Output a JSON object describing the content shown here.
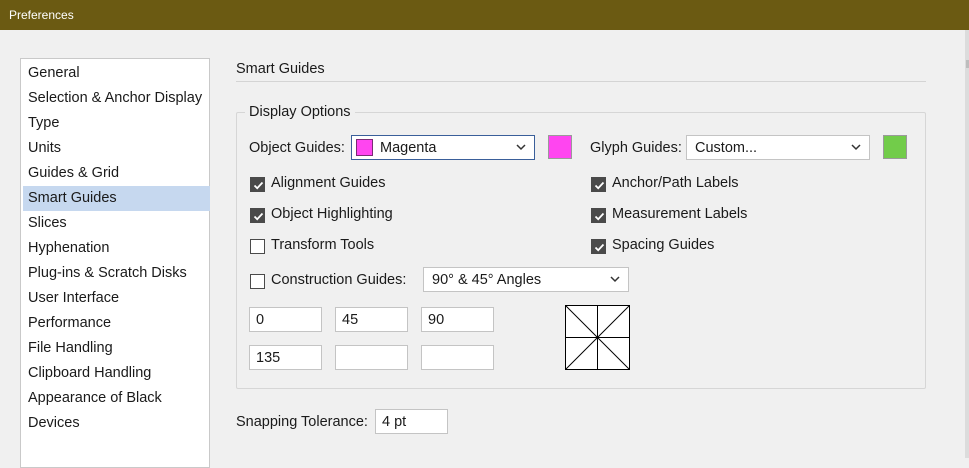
{
  "window": {
    "title": "Preferences"
  },
  "sidebar": {
    "items": [
      {
        "label": "General"
      },
      {
        "label": "Selection & Anchor Display"
      },
      {
        "label": "Type"
      },
      {
        "label": "Units"
      },
      {
        "label": "Guides & Grid"
      },
      {
        "label": "Smart Guides",
        "selected": true
      },
      {
        "label": "Slices"
      },
      {
        "label": "Hyphenation"
      },
      {
        "label": "Plug-ins & Scratch Disks"
      },
      {
        "label": "User Interface"
      },
      {
        "label": "Performance"
      },
      {
        "label": "File Handling"
      },
      {
        "label": "Clipboard Handling"
      },
      {
        "label": "Appearance of Black"
      },
      {
        "label": "Devices"
      }
    ]
  },
  "panel": {
    "title": "Smart Guides",
    "display_options": {
      "label": "Display Options",
      "object_guides": {
        "label": "Object Guides:",
        "value": "Magenta",
        "color": "#ff45f0"
      },
      "glyph_guides": {
        "label": "Glyph Guides:",
        "value": "Custom...",
        "color": "#72cc4a"
      },
      "checkboxes_left": [
        {
          "label": "Alignment Guides",
          "checked": true
        },
        {
          "label": "Object Highlighting",
          "checked": true
        },
        {
          "label": "Transform Tools",
          "checked": false
        }
      ],
      "checkboxes_right": [
        {
          "label": "Anchor/Path Labels",
          "checked": true
        },
        {
          "label": "Measurement Labels",
          "checked": true
        },
        {
          "label": "Spacing Guides",
          "checked": true
        }
      ],
      "construction_guides": {
        "label": "Construction Guides:",
        "checked": false,
        "value": "90° & 45° Angles"
      },
      "angles": [
        "0",
        "45",
        "90",
        "135",
        "",
        ""
      ]
    },
    "snapping": {
      "label": "Snapping Tolerance:",
      "value": "4 pt"
    }
  },
  "colors": {
    "titlebar": "#6b5a12",
    "selected_item": "#c6d8ef",
    "magenta": "#ff45f0",
    "green": "#72cc4a"
  }
}
